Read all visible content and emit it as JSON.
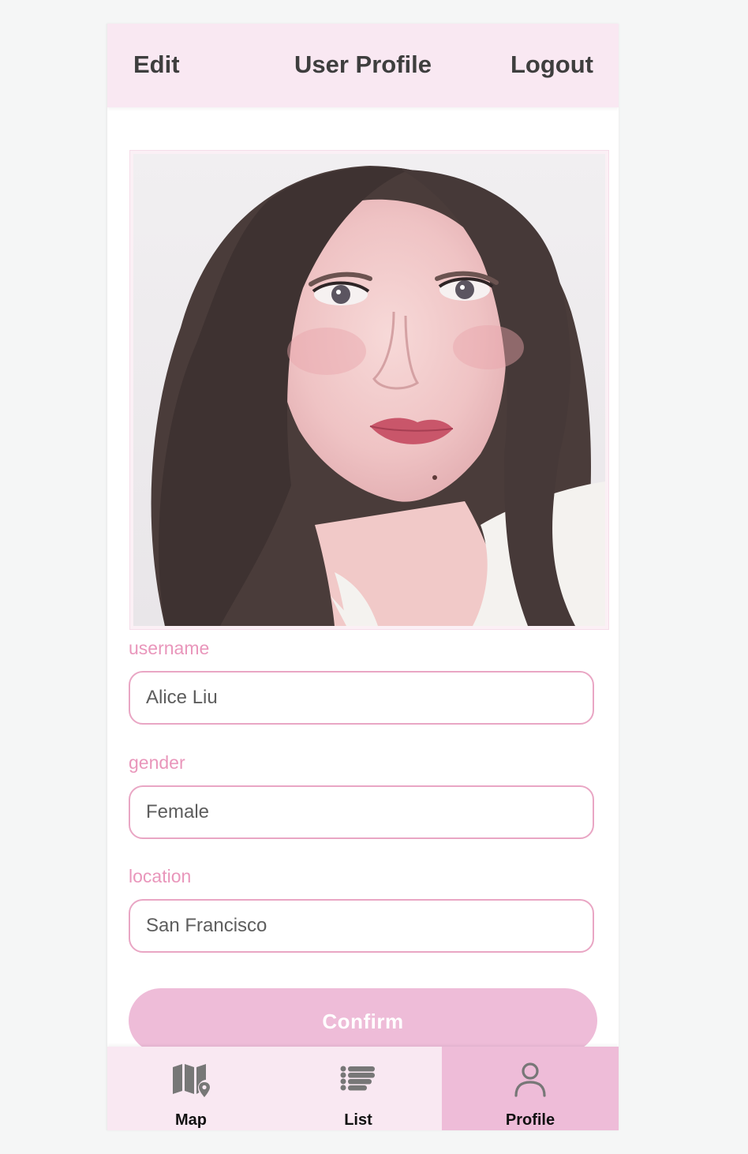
{
  "header": {
    "edit_label": "Edit",
    "title": "User Profile",
    "logout_label": "Logout"
  },
  "profile_photo": {
    "alt": "profile photo"
  },
  "form": {
    "username": {
      "label": "username",
      "value": "Alice Liu"
    },
    "gender": {
      "label": "gender",
      "value": "Female"
    },
    "location": {
      "label": "location",
      "value": "San Francisco"
    },
    "confirm_label": "Confirm"
  },
  "tabs": [
    {
      "label": "Map",
      "icon": "map-icon",
      "active": false
    },
    {
      "label": "List",
      "icon": "list-icon",
      "active": false
    },
    {
      "label": "Profile",
      "icon": "user-icon",
      "active": true
    }
  ],
  "colors": {
    "bar_bg": "#f9e8f2",
    "accent": "#eebcd8",
    "label_pink": "#e996bb",
    "field_border": "#e9a6c4"
  }
}
